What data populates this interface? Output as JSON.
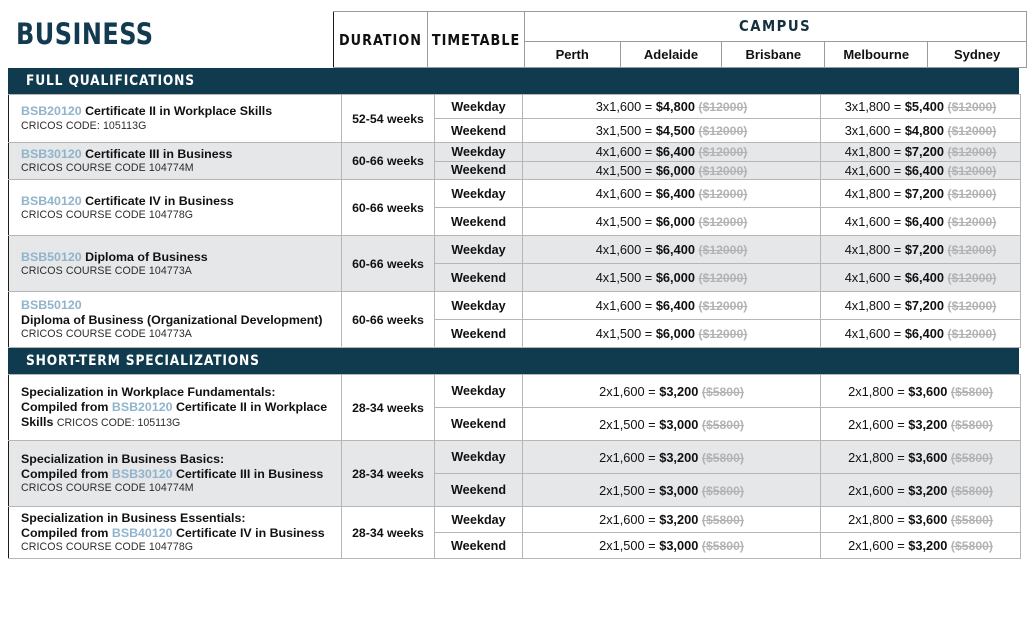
{
  "header": {
    "title": "BUSINESS",
    "duration_label": "DURATION",
    "timetable_label": "TIMETABLE",
    "campus_label": "CAMPUS",
    "campuses": [
      "Perth",
      "Adelaide",
      "Brisbane",
      "Melbourne",
      "Sydney"
    ]
  },
  "colors": {
    "navy": "#103a4d",
    "campus_band": "#8ab5cb",
    "code_blue": "#8fb4cb",
    "alt_row": "#e5e7e8",
    "strikethrough": "#b3b3b3"
  },
  "sections": [
    {
      "title": "FULL QUALIFICATIONS",
      "courses": [
        {
          "code": "BSB20120",
          "name": "Certificate II in Workplace Skills",
          "name_prefix": "",
          "cricos": "CRICOS CODE: 105113G",
          "cricos_inline": false,
          "duration": "52-54 weeks",
          "rows": [
            {
              "timetable": "Weekday",
              "group_a": {
                "mul": "3x1,600 = ",
                "now": "$4,800",
                "was": "($12000)"
              },
              "group_b": {
                "mul": "3x1,800 = ",
                "now": "$5,400",
                "was": "($12000)"
              }
            },
            {
              "timetable": "Weekend",
              "group_a": {
                "mul": "3x1,500 = ",
                "now": "$4,500",
                "was": "($12000)"
              },
              "group_b": {
                "mul": "3x1,600 = ",
                "now": "$4,800",
                "was": "($12000)"
              }
            }
          ]
        },
        {
          "code": "BSB30120",
          "name": "Certificate III in Business",
          "cricos": "CRICOS COURSE CODE 104774M",
          "duration": "60-66 weeks",
          "rows": [
            {
              "timetable": "Weekday",
              "group_a": {
                "mul": "4x1,600 = ",
                "now": "$6,400",
                "was": "($12000)"
              },
              "group_b": {
                "mul": "4x1,800 = ",
                "now": "$7,200",
                "was": "($12000)"
              }
            },
            {
              "timetable": "Weekend",
              "group_a": {
                "mul": "4x1,500 = ",
                "now": "$6,000",
                "was": "($12000)"
              },
              "group_b": {
                "mul": "4x1,600 = ",
                "now": "$6,400",
                "was": "($12000)"
              }
            }
          ]
        },
        {
          "code": "BSB40120",
          "name": "Certificate IV in Business",
          "cricos": "CRICOS COURSE CODE 104778G",
          "duration": "60-66 weeks",
          "rows": [
            {
              "timetable": "Weekday",
              "group_a": {
                "mul": "4x1,600 = ",
                "now": "$6,400",
                "was": "($12000)"
              },
              "group_b": {
                "mul": "4x1,800 = ",
                "now": "$7,200",
                "was": "($12000)"
              }
            },
            {
              "timetable": "Weekend",
              "group_a": {
                "mul": "4x1,500 = ",
                "now": "$6,000",
                "was": "($12000)"
              },
              "group_b": {
                "mul": "4x1,600 = ",
                "now": "$6,400",
                "was": "($12000)"
              }
            }
          ]
        },
        {
          "code": "BSB50120",
          "name": "Diploma of Business",
          "cricos": "CRICOS COURSE CODE 104773A",
          "duration": "60-66 weeks",
          "rows": [
            {
              "timetable": "Weekday",
              "group_a": {
                "mul": "4x1,600 = ",
                "now": "$6,400",
                "was": "($12000)"
              },
              "group_b": {
                "mul": "4x1,800 = ",
                "now": "$7,200",
                "was": "($12000)"
              }
            },
            {
              "timetable": "Weekend",
              "group_a": {
                "mul": "4x1,500 = ",
                "now": "$6,000",
                "was": "($12000)"
              },
              "group_b": {
                "mul": "4x1,600 = ",
                "now": "$6,400",
                "was": "($12000)"
              }
            }
          ]
        },
        {
          "code": "BSB50120",
          "name": "Diploma of Business (Organizational Development)",
          "cricos": "CRICOS COURSE CODE 104773A",
          "stacked": true,
          "duration": "60-66 weeks",
          "rows": [
            {
              "timetable": "Weekday",
              "group_a": {
                "mul": "4x1,600 = ",
                "now": "$6,400",
                "was": "($12000)"
              },
              "group_b": {
                "mul": "4x1,800 = ",
                "now": "$7,200",
                "was": "($12000)"
              }
            },
            {
              "timetable": "Weekend",
              "group_a": {
                "mul": "4x1,500 = ",
                "now": "$6,000",
                "was": "($12000)"
              },
              "group_b": {
                "mul": "4x1,600 = ",
                "now": "$6,400",
                "was": "($12000)"
              }
            }
          ]
        }
      ]
    },
    {
      "title": "SHORT-TERM SPECIALIZATIONS",
      "courses": [
        {
          "spec_title": "Specialization in Workplace Fundamentals:",
          "compiled_prefix": "Compiled from ",
          "code": "BSB20120",
          "name": " Certificate II in Workplace Skills ",
          "cricos": "CRICOS CODE: 105113G",
          "cricos_inline": true,
          "duration": "28-34 weeks",
          "rows": [
            {
              "timetable": "Weekday",
              "group_a": {
                "mul": "2x1,600 = ",
                "now": "$3,200",
                "was": "($5800)"
              },
              "group_b": {
                "mul": "2x1,800 = ",
                "now": "$3,600",
                "was": "($5800)"
              }
            },
            {
              "timetable": "Weekend",
              "group_a": {
                "mul": "2x1,500 = ",
                "now": "$3,000",
                "was": "($5800)"
              },
              "group_b": {
                "mul": "2x1,600 = ",
                "now": "$3,200",
                "was": "($5800)"
              }
            }
          ]
        },
        {
          "spec_title": "Specialization in Business Basics:",
          "compiled_prefix": "Compiled from ",
          "code": "BSB30120",
          "name": " Certificate III in Business",
          "cricos": "CRICOS COURSE CODE 104774M",
          "cricos_inline": false,
          "duration": "28-34 weeks",
          "rows": [
            {
              "timetable": "Weekday",
              "group_a": {
                "mul": "2x1,600 = ",
                "now": "$3,200",
                "was": "($5800)"
              },
              "group_b": {
                "mul": "2x1,800 = ",
                "now": "$3,600",
                "was": "($5800)"
              }
            },
            {
              "timetable": "Weekend",
              "group_a": {
                "mul": "2x1,500 = ",
                "now": "$3,000",
                "was": "($5800)"
              },
              "group_b": {
                "mul": "2x1,600 = ",
                "now": "$3,200",
                "was": "($5800)"
              }
            }
          ]
        },
        {
          "spec_title": "Specialization in Business Essentials:",
          "compiled_prefix": "Compiled from ",
          "code": "BSB40120",
          "name": " Certificate IV in Business",
          "cricos": "CRICOS COURSE CODE 104778G",
          "cricos_inline": false,
          "duration": "28-34 weeks",
          "rows": [
            {
              "timetable": "Weekday",
              "group_a": {
                "mul": "2x1,600 = ",
                "now": "$3,200",
                "was": "($5800)"
              },
              "group_b": {
                "mul": "2x1,800 = ",
                "now": "$3,600",
                "was": "($5800)"
              }
            },
            {
              "timetable": "Weekend",
              "group_a": {
                "mul": "2x1,500 = ",
                "now": "$3,000",
                "was": "($5800)"
              },
              "group_b": {
                "mul": "2x1,600 = ",
                "now": "$3,200",
                "was": "($5800)"
              }
            }
          ]
        }
      ]
    }
  ]
}
